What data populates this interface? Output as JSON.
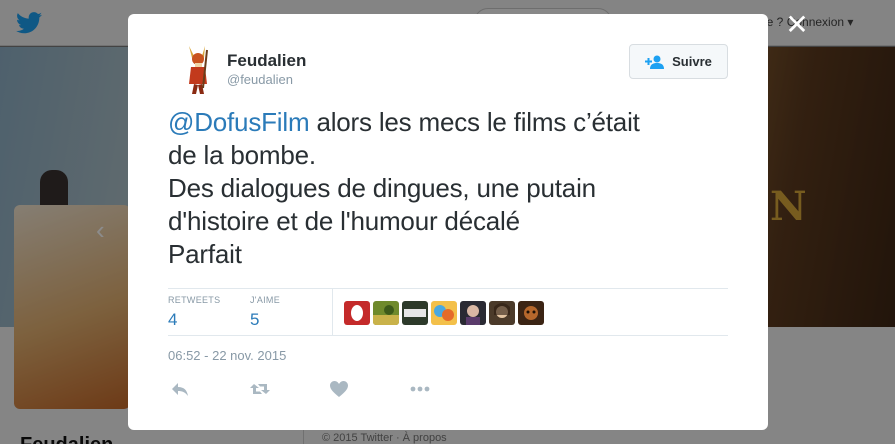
{
  "background": {
    "login_text": "de ? Connexion ▾",
    "profile_name": "Feudalien",
    "footer_text": "© 2015 Twitter · À propos",
    "banner_letter": "N"
  },
  "modal": {
    "close_glyph": "✕",
    "author": {
      "name": "Feudalien",
      "handle": "@feudalien"
    },
    "follow_button": {
      "label": "Suivre"
    },
    "tweet": {
      "mention": "@DofusFilm",
      "line1_rest": " alors les mecs le films c’était",
      "line2": "de la bombe.",
      "line3": "Des dialogues de dingues, une putain",
      "line4": "d'histoire et de l'humour décalé",
      "line5": "Parfait"
    },
    "stats": {
      "retweets_label": "RETWEETS",
      "retweets_value": "4",
      "likes_label": "J'AIME",
      "likes_value": "5"
    },
    "timestamp": "06:52 - 22 nov. 2015",
    "actions": [
      "reply-icon",
      "retweet-icon",
      "like-icon",
      "more-icon"
    ]
  },
  "colors": {
    "link": "#2b7bb9",
    "text": "#292f33",
    "muted": "#8899a6"
  }
}
